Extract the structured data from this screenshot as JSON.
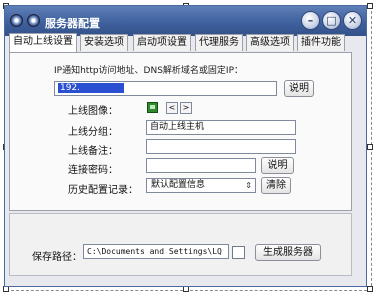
{
  "window": {
    "title": "服务器配置",
    "buttons": {
      "minimize": "–",
      "restore": "□",
      "close": "✕"
    }
  },
  "tabs": [
    "自动上线设置",
    "安装选项",
    "启动项设置",
    "代理服务",
    "高级选项",
    "插件功能"
  ],
  "main": {
    "hint": "IP通知http访问地址、DNS解析域名或固定IP：",
    "address_value": "192.",
    "explain_label": "说明",
    "online_icon_label": "上线图像：",
    "nav_prev": "<",
    "nav_next": ">",
    "group_label": "上线分组：",
    "group_value": "自动上线主机",
    "remark_label": "上线备注：",
    "remark_value": "",
    "password_label": "连接密码：",
    "password_value": "",
    "password_explain": "说明",
    "history_label": "历史配置记录：",
    "history_value": "默认配置信息",
    "clear_label": "清除"
  },
  "bottom": {
    "save_path_label": "保存路径：",
    "save_path_value": "C:\\Documents and Settings\\LQ",
    "generate_label": "生成服务器"
  }
}
